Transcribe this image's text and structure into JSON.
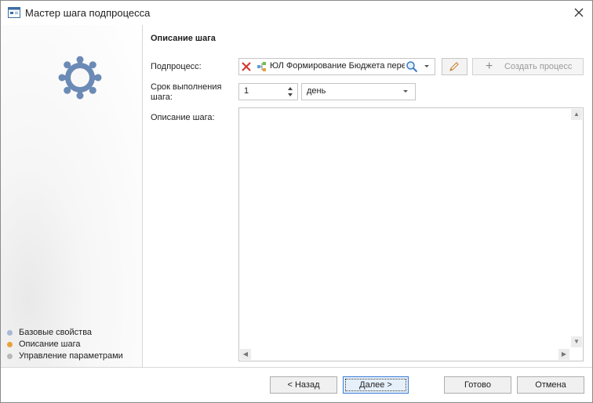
{
  "window": {
    "title": "Мастер шага подпроцесса",
    "icon": "window-icon",
    "close_icon": "close-icon"
  },
  "sidebar": {
    "icon": "gear-icon",
    "accent_color": "#6b8ab5",
    "steps": [
      {
        "label": "Базовые свойства",
        "dot_color": "#a9b8d4",
        "active": false
      },
      {
        "label": "Описание шага",
        "dot_color": "#e9a13b",
        "active": true
      },
      {
        "label": "Управление параметрами",
        "dot_color": "#b9b9b9",
        "active": false
      }
    ]
  },
  "main": {
    "section_title": "Описание шага",
    "subprocess": {
      "label": "Подпроцесс:",
      "value": "ЮЛ Формирование Бюджета пере",
      "clear_icon": "clear-x-icon",
      "process_icon": "process-icon",
      "search_icon": "search-icon",
      "edit_icon": "pencil-icon"
    },
    "create_button": {
      "label": "Создать процесс",
      "icon": "plus-icon"
    },
    "deadline": {
      "label_line1": "Срок выполнения",
      "label_line2": "шага:",
      "value": "1",
      "unit": "день"
    },
    "description": {
      "label": "Описание шага:",
      "value": ""
    }
  },
  "footer": {
    "back_label": "< Назад",
    "next_label": "Далее >",
    "done_label": "Готово",
    "cancel_label": "Отмена"
  }
}
